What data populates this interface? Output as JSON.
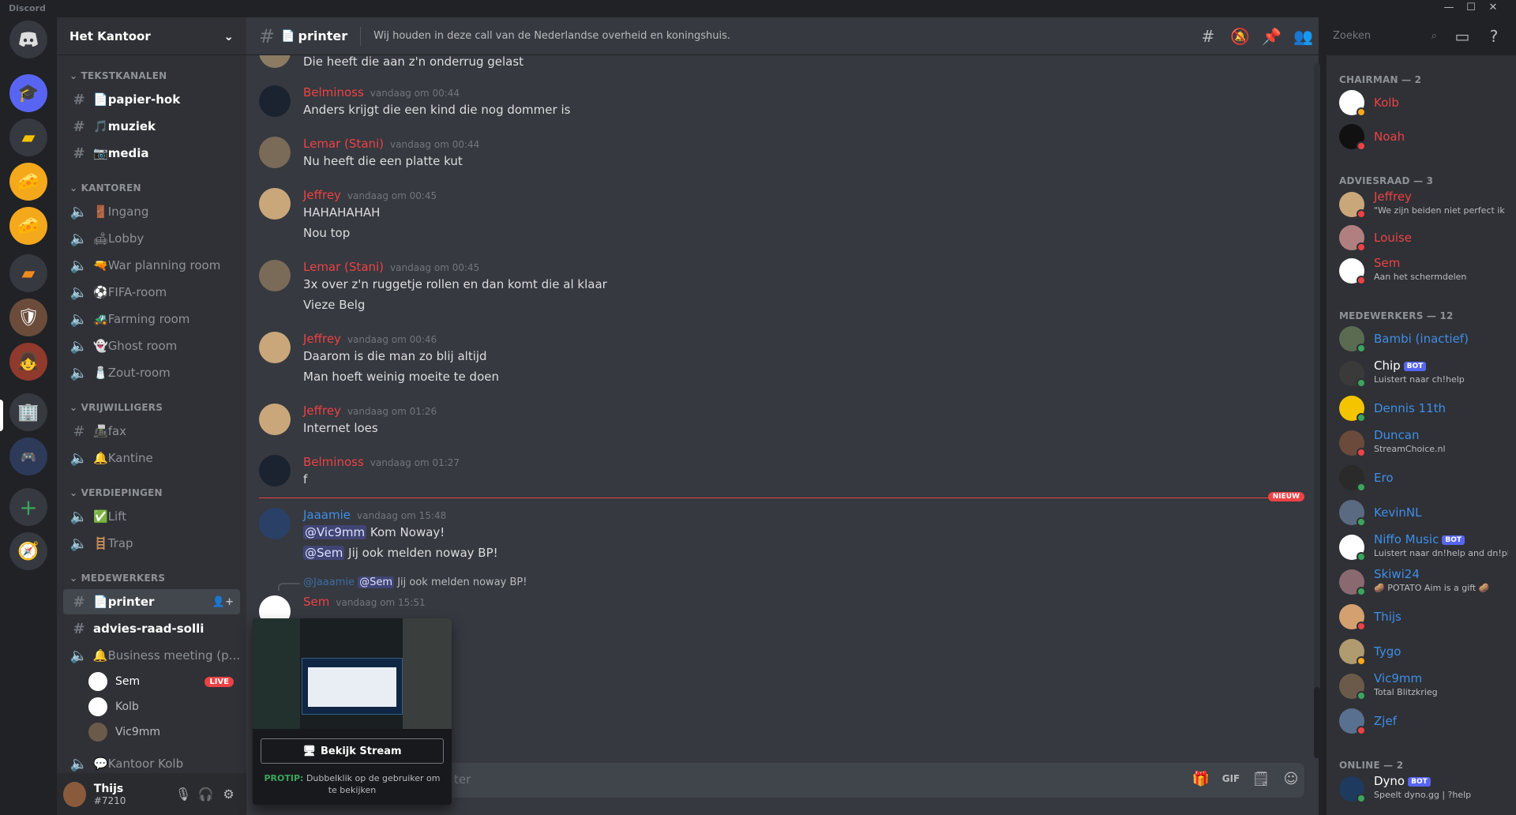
{
  "app": {
    "title": "Discord",
    "colors": {
      "accent": "#5865f2",
      "danger": "#ed4245",
      "online": "#3ba55d",
      "idle": "#faa61a",
      "background": "#36393f"
    }
  },
  "server": {
    "name": "Het Kantoor"
  },
  "sidebar": {
    "categories": [
      "TEKSTKANALEN",
      "KANTOREN",
      "VRIJWILLIGERS",
      "VERDIEPINGEN",
      "MEDEWERKERS"
    ],
    "tekstkanalen": [
      {
        "icon": "📄",
        "name": "papier-hok"
      },
      {
        "icon": "🎵",
        "name": "muziek"
      },
      {
        "icon": "📷",
        "name": "media"
      }
    ],
    "kantoren": [
      {
        "icon": "🚪",
        "name": "Ingang"
      },
      {
        "icon": "🛋",
        "name": "Lobby"
      },
      {
        "icon": "🔫",
        "name": "War planning room"
      },
      {
        "icon": "⚽",
        "name": "FIFA-room"
      },
      {
        "icon": "🚜",
        "name": "Farming room"
      },
      {
        "icon": "👻",
        "name": "Ghost room"
      },
      {
        "icon": "🧂",
        "name": "Zout-room"
      }
    ],
    "vrijwilligers": [
      {
        "icon": "📠",
        "name": "fax"
      },
      {
        "icon": "🔔",
        "name": "Kantine"
      }
    ],
    "verdiepingen": [
      {
        "icon": "✅",
        "name": "Lift"
      },
      {
        "icon": "🪜",
        "name": "Trap"
      }
    ],
    "medewerkers": [
      {
        "icon": "📄",
        "name": "printer"
      },
      {
        "icon": "",
        "name": "advies-raad-solli"
      },
      {
        "icon": "🔔",
        "name": "Business meeting (p..."
      }
    ],
    "voice_users": [
      {
        "name": "Sem",
        "live": "LIVE"
      },
      {
        "name": "Kolb"
      },
      {
        "name": "Vic9mm"
      }
    ],
    "last_channel": {
      "icon": "💬",
      "name": "Kantoor Kolb"
    }
  },
  "user_panel": {
    "name": "Thijs",
    "tag": "#7210"
  },
  "channel_header": {
    "name": "printer",
    "topic": "Wij houden in deze call van de Nederlandse overheid en koningshuis.",
    "search_placeholder": "Zoeken"
  },
  "messages": [
    {
      "author": "",
      "time": "",
      "lines": [
        "Die heeft die aan z'n onderrug gelast"
      ]
    },
    {
      "author": "Belminoss",
      "time": "vandaag om 00:44",
      "lines": [
        "Anders krijgt die een kind die nog dommer is"
      ]
    },
    {
      "author": "Lemar (Stani)",
      "time": "vandaag om 00:44",
      "lines": [
        "Nu heeft die een platte kut"
      ]
    },
    {
      "author": "Jeffrey",
      "time": "vandaag om 00:45",
      "lines": [
        "HAHAHAHAH",
        "Nou top"
      ]
    },
    {
      "author": "Lemar (Stani)",
      "time": "vandaag om 00:45",
      "lines": [
        "3x over z'n ruggetje rollen en dan komt die al klaar",
        "Vieze Belg"
      ]
    },
    {
      "author": "Jeffrey",
      "time": "vandaag om 00:46",
      "lines": [
        "Daarom is die man zo blij altijd",
        "Man hoeft weinig moeite te doen"
      ]
    },
    {
      "author": "Jeffrey",
      "time": "vandaag om 01:26",
      "lines": [
        "Internet loes"
      ]
    },
    {
      "author": "Belminoss",
      "time": "vandaag om 01:27",
      "lines": [
        "f"
      ]
    },
    {
      "author": "Jaaamie",
      "time": "vandaag om 15:48",
      "mention1": "@Vic9mm",
      "line1": " Kom Noway!",
      "mention2": "@Sem",
      "line2": " Jij ook melden noway BP!"
    },
    {
      "reply_author": "@Jaaamie",
      "reply_mention": "@Sem",
      "reply_text": " Jij ook melden noway BP!",
      "author": "Sem",
      "time": "vandaag om 15:51"
    }
  ],
  "new_badge": "NIEUW",
  "stream_popout": {
    "button": "Bekijk Stream",
    "protip_label": "PROTIP:",
    "protip_text": " Dubbelklik op de gebruiker om te bekijken"
  },
  "composer": {
    "placeholder_tail": "ter"
  },
  "members": {
    "groups": [
      {
        "title": "CHAIRMAN — 2"
      },
      {
        "title": "ADVIESRAAD — 3"
      },
      {
        "title": "MEDEWERKERS — 12"
      },
      {
        "title": "ONLINE — 2"
      }
    ],
    "list": [
      {
        "name": "Kolb",
        "color": "#ed4245",
        "status": "idle"
      },
      {
        "name": "Noah",
        "color": "#ed4245",
        "status": "dnd"
      },
      {
        "name": "Jeffrey",
        "color": "#ed4245",
        "sub": "\"We zijn beiden niet perfect ik ...",
        "status": "dnd"
      },
      {
        "name": "Louise",
        "color": "#ed4245",
        "status": "dnd"
      },
      {
        "name": "Sem",
        "color": "#ed4245",
        "sub": "Aan het schermdelen",
        "status": "dnd"
      },
      {
        "name": "Bambi (inactief)",
        "color": "#3f8ee8",
        "status": "online"
      },
      {
        "name": "Chip",
        "color": "#ffffff",
        "bot": "BOT",
        "sub": "Luistert naar ch!help",
        "status": "online"
      },
      {
        "name": "Dennis 11th",
        "color": "#3f8ee8",
        "status": "online"
      },
      {
        "name": "Duncan",
        "color": "#3f8ee8",
        "sub": "StreamChoice.nl",
        "status": "dnd"
      },
      {
        "name": "Ero",
        "color": "#3f8ee8",
        "status": "online"
      },
      {
        "name": "KevinNL",
        "color": "#3f8ee8",
        "status": "online"
      },
      {
        "name": "Niffo Music",
        "color": "#3f8ee8",
        "bot": "BOT",
        "sub": "Luistert naar dn!help and dn!pl...",
        "status": "online"
      },
      {
        "name": "Skiwi24",
        "color": "#3f8ee8",
        "sub": "🥔 POTATO Aim is a gift 🥔",
        "status": "online"
      },
      {
        "name": "Thijs",
        "color": "#3f8ee8",
        "status": "dnd"
      },
      {
        "name": "Tygo",
        "color": "#3f8ee8",
        "status": "idle"
      },
      {
        "name": "Vic9mm",
        "color": "#3f8ee8",
        "sub": "Total Blitzkrieg",
        "status": "online"
      },
      {
        "name": "Zjef",
        "color": "#3f8ee8",
        "status": "dnd"
      },
      {
        "name": "Dyno",
        "color": "#ffffff",
        "bot": "BOT",
        "sub": "Speelt dyno.gg | ?help",
        "status": "online"
      }
    ]
  }
}
